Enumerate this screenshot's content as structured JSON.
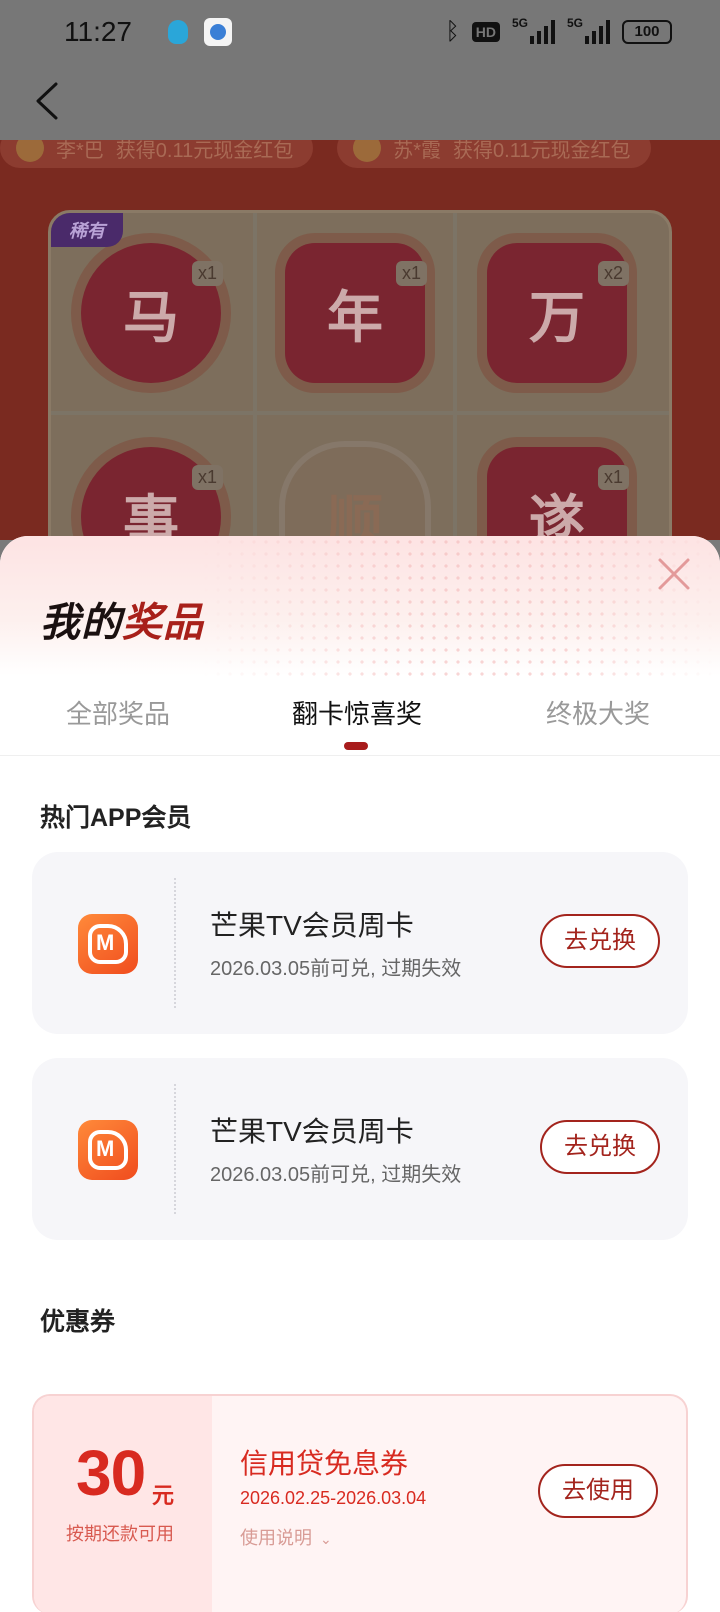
{
  "status_bar": {
    "time": "11:27",
    "app_icons": [
      "qq-icon",
      "browser-icon"
    ],
    "hd_label": "HD",
    "signal_labels": [
      "5G",
      "5G"
    ],
    "battery": "100"
  },
  "nav": {
    "back_icon": "chevron-left-icon"
  },
  "background_page": {
    "ticker": [
      {
        "name": "李*巴",
        "text": "获得0.11元现金红包"
      },
      {
        "name": "苏*霞",
        "text": "获得0.11元现金红包"
      }
    ],
    "rare_tag": "稀有",
    "tiles": [
      {
        "char": "马",
        "count": "x1",
        "shape": "flower"
      },
      {
        "char": "年",
        "count": "x1",
        "shape": "octagon"
      },
      {
        "char": "万",
        "count": "x2",
        "shape": "octagon"
      },
      {
        "char": "事",
        "count": "x1",
        "shape": "flower"
      },
      {
        "char": "顺",
        "count": "",
        "shape": "arch"
      },
      {
        "char": "遂",
        "count": "x1",
        "shape": "octagon"
      }
    ]
  },
  "sheet": {
    "title_black": "我的",
    "title_red": "奖品",
    "close_icon": "close-icon",
    "tabs": [
      {
        "label": "全部奖品",
        "active": false
      },
      {
        "label": "翻卡惊喜奖",
        "active": true
      },
      {
        "label": "终极大奖",
        "active": false
      }
    ],
    "sections": {
      "app_members": {
        "title": "热门APP会员",
        "items": [
          {
            "logo": "mango-tv-logo",
            "name": "芒果TV会员周卡",
            "expiry": "2026.03.05前可兑, 过期失效",
            "action": "去兑换"
          },
          {
            "logo": "mango-tv-logo",
            "name": "芒果TV会员周卡",
            "expiry": "2026.03.05前可兑, 过期失效",
            "action": "去兑换"
          }
        ]
      },
      "coupons": {
        "title": "优惠券",
        "items": [
          {
            "amount": "30",
            "unit": "元",
            "condition": "按期还款可用",
            "name": "信用贷免息券",
            "dates": "2026.02.25-2026.03.04",
            "usage": "使用说明",
            "action": "去使用"
          }
        ]
      }
    }
  },
  "colors": {
    "accent": "#a3241d",
    "coupon_red": "#d82a20",
    "tab_indicator": "#a81c1c"
  }
}
